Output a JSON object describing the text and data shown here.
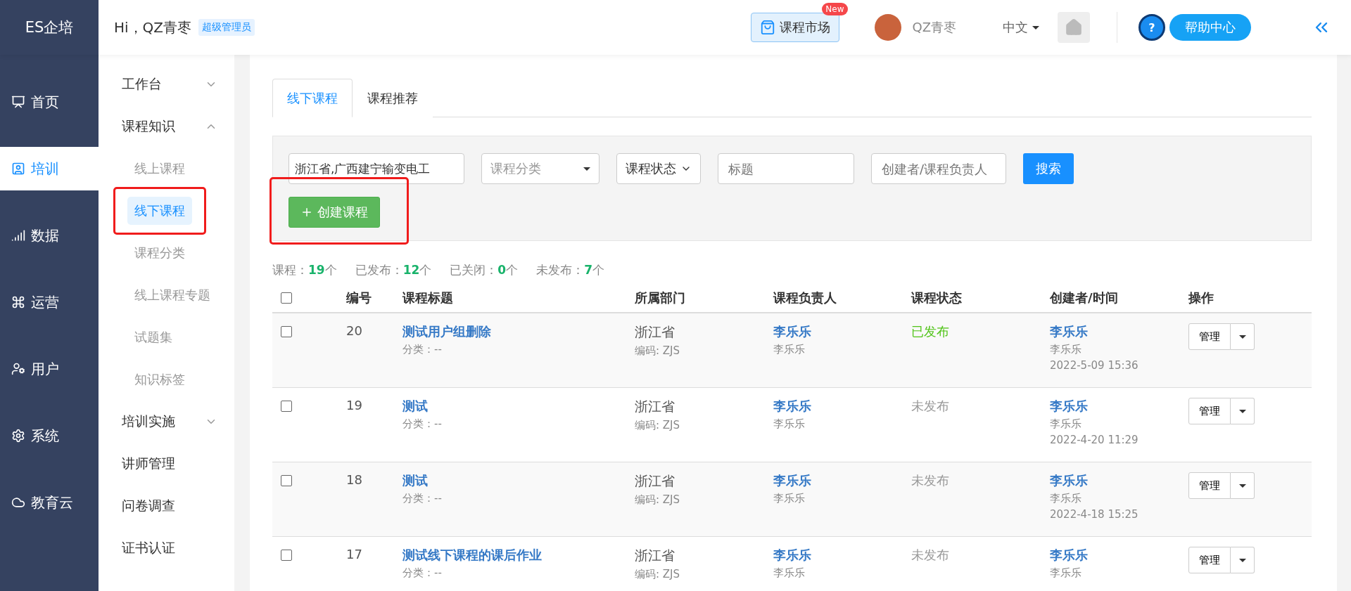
{
  "brand": "ES企培",
  "greeting": "Hi，QZ青枣",
  "role_badge": "超级管理员",
  "market": {
    "label": "课程市场",
    "badge": "New"
  },
  "user": {
    "name": "QZ青枣"
  },
  "language": "中文",
  "help": "帮助中心",
  "help_icon": "?",
  "rail": [
    {
      "label": "首页",
      "selected": false
    },
    {
      "label": "培训",
      "selected": true
    },
    {
      "label": "数据",
      "selected": false
    },
    {
      "label": "运营",
      "selected": false
    },
    {
      "label": "用户",
      "selected": false
    },
    {
      "label": "系统",
      "selected": false
    },
    {
      "label": "教育云",
      "selected": false
    }
  ],
  "menu": [
    {
      "label": "工作台",
      "kind": "group",
      "expanded": false
    },
    {
      "label": "课程知识",
      "kind": "group",
      "expanded": true,
      "children": [
        {
          "label": "线上课程",
          "selected": false,
          "highlighted": false
        },
        {
          "label": "线下课程",
          "selected": true,
          "highlighted": true
        },
        {
          "label": "课程分类",
          "selected": false,
          "highlighted": false
        },
        {
          "label": "线上课程专题",
          "selected": false,
          "highlighted": false
        },
        {
          "label": "试题集",
          "selected": false,
          "highlighted": false
        },
        {
          "label": "知识标签",
          "selected": false,
          "highlighted": false
        }
      ]
    },
    {
      "label": "培训实施",
      "kind": "group",
      "expanded": false
    },
    {
      "label": "讲师管理",
      "kind": "link"
    },
    {
      "label": "问卷调查",
      "kind": "link"
    },
    {
      "label": "证书认证",
      "kind": "link"
    }
  ],
  "tabs": [
    {
      "label": "线下课程",
      "selected": true
    },
    {
      "label": "课程推荐",
      "selected": false
    }
  ],
  "filters": {
    "department": {
      "value": "浙江省,广西建宁输变电工"
    },
    "category": {
      "placeholder": "课程分类"
    },
    "status": {
      "value": "课程状态"
    },
    "title": {
      "placeholder": "标题"
    },
    "creator": {
      "placeholder": "创建者/课程负责人"
    },
    "search": "搜索",
    "create": {
      "label": "创建课程",
      "highlighted": true
    }
  },
  "stats": [
    {
      "label": "课程：",
      "value": "19",
      "unit": "个"
    },
    {
      "label": "已发布：",
      "value": "12",
      "unit": "个"
    },
    {
      "label": "已关闭：",
      "value": "0",
      "unit": "个"
    },
    {
      "label": "未发布：",
      "value": "7",
      "unit": "个"
    }
  ],
  "table": {
    "checked": false,
    "columns": [
      "编号",
      "课程标题",
      "所属部门",
      "课程负责人",
      "课程状态",
      "创建者/时间",
      "操作"
    ],
    "rows": [
      {
        "checked": false,
        "id": "20",
        "title": "测试用户组删除",
        "category": "分类：--",
        "dept": "浙江省",
        "code": "编码: ZJS",
        "owner": "李乐乐",
        "owner_sub": "李乐乐",
        "status": {
          "text": "已发布",
          "kind": "published"
        },
        "creator": "李乐乐",
        "creator_sub": "李乐乐",
        "time": "2022-5-09 15:36",
        "action": "管理"
      },
      {
        "checked": false,
        "id": "19",
        "title": "测试",
        "category": "分类：--",
        "dept": "浙江省",
        "code": "编码: ZJS",
        "owner": "李乐乐",
        "owner_sub": "李乐乐",
        "status": {
          "text": "未发布",
          "kind": "draft"
        },
        "creator": "李乐乐",
        "creator_sub": "李乐乐",
        "time": "2022-4-20 11:29",
        "action": "管理"
      },
      {
        "checked": false,
        "id": "18",
        "title": "测试",
        "category": "分类：--",
        "dept": "浙江省",
        "code": "编码: ZJS",
        "owner": "李乐乐",
        "owner_sub": "李乐乐",
        "status": {
          "text": "未发布",
          "kind": "draft"
        },
        "creator": "李乐乐",
        "creator_sub": "李乐乐",
        "time": "2022-4-18 15:25",
        "action": "管理"
      },
      {
        "checked": false,
        "id": "17",
        "title": "测试线下课程的课后作业",
        "category": "分类：--",
        "dept": "浙江省",
        "code": "编码: ZJS",
        "owner": "李乐乐",
        "owner_sub": "李乐乐",
        "status": {
          "text": "未发布",
          "kind": "draft"
        },
        "creator": "李乐乐",
        "creator_sub": "李乐乐",
        "action": "管理"
      }
    ]
  }
}
